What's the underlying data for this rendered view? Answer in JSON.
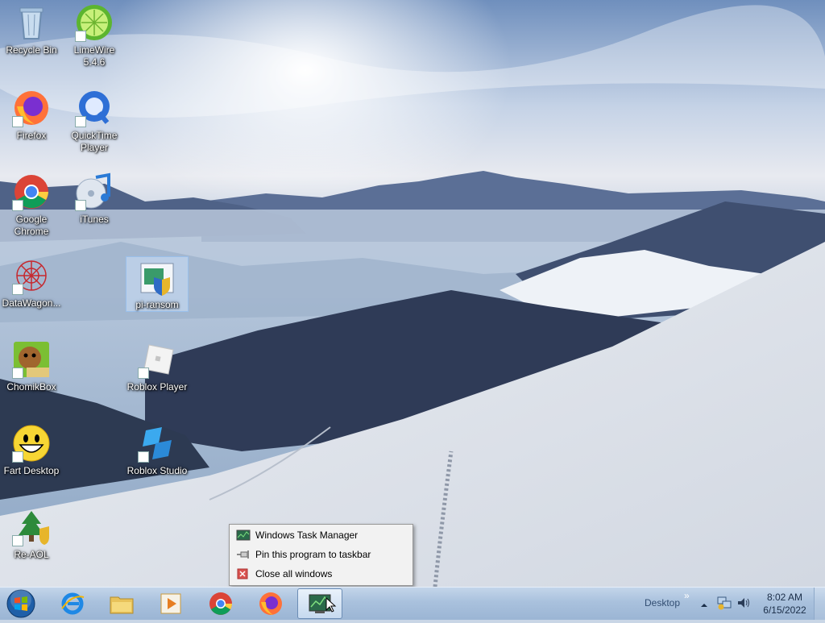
{
  "desktop": {
    "icons": [
      {
        "label": "Recycle Bin"
      },
      {
        "label": "LimeWire 5.4.6"
      },
      {
        "label": "Firefox"
      },
      {
        "label": "QuickTime Player"
      },
      {
        "label": "Google Chrome"
      },
      {
        "label": "iTunes"
      },
      {
        "label": "DataWagon..."
      },
      {
        "label": "pi-ransom"
      },
      {
        "label": "ChomikBox"
      },
      {
        "label": "Roblox Player"
      },
      {
        "label": "Fart Desktop"
      },
      {
        "label": "Roblox Studio"
      },
      {
        "label": "Re-AOL"
      }
    ]
  },
  "context_menu": {
    "items": [
      {
        "label": "Windows Task Manager",
        "icon": "task-manager-icon"
      },
      {
        "label": "Pin this program to taskbar",
        "icon": "pin-icon"
      },
      {
        "label": "Close all windows",
        "icon": "close-icon"
      }
    ]
  },
  "taskbar": {
    "pinned": [
      {
        "icon": "internet-explorer-icon"
      },
      {
        "icon": "file-explorer-icon"
      },
      {
        "icon": "media-player-icon"
      },
      {
        "icon": "chrome-icon"
      },
      {
        "icon": "firefox-icon"
      },
      {
        "icon": "task-manager-icon"
      }
    ],
    "desktop_label": "Desktop",
    "chevron": "»",
    "clock": {
      "time": "8:02 AM",
      "date": "6/15/2022"
    }
  }
}
